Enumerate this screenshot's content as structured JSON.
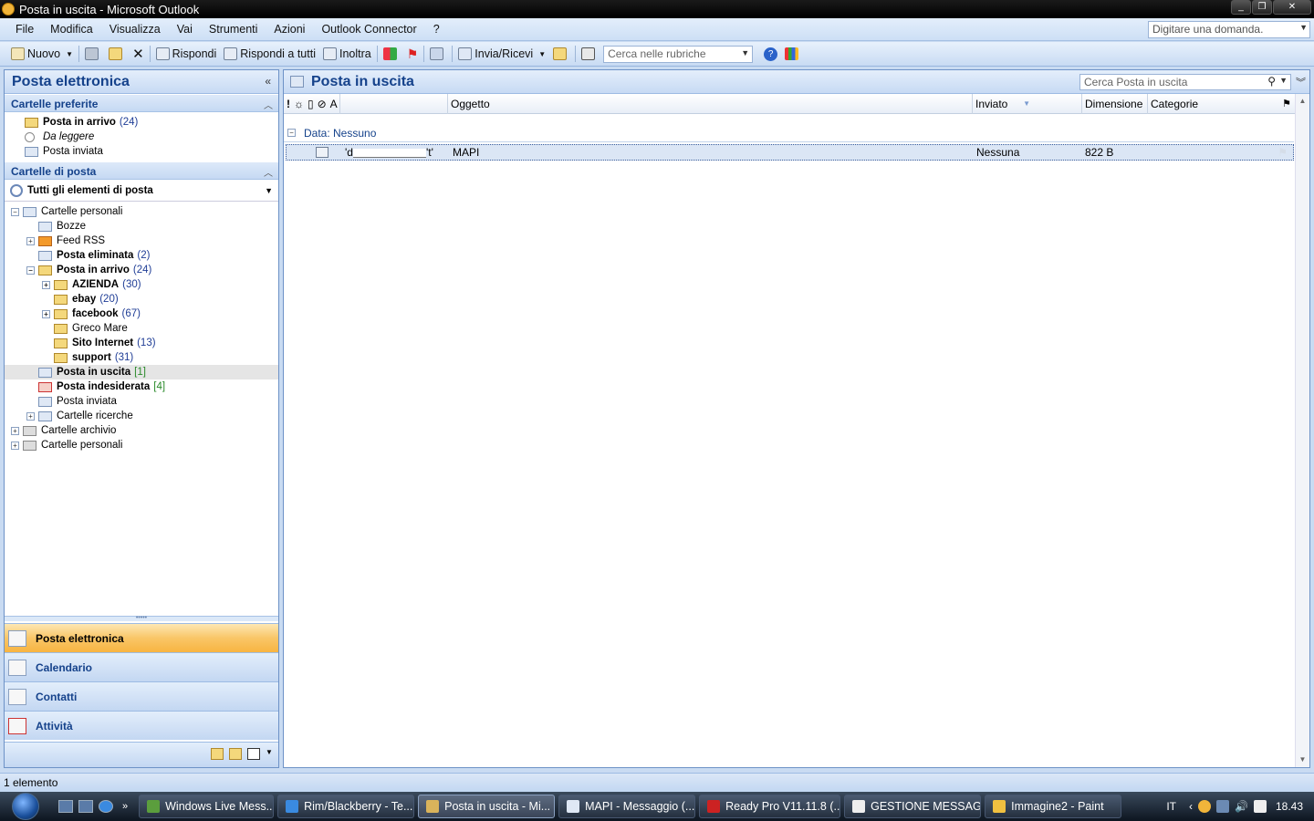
{
  "window": {
    "title": "Posta in uscita - Microsoft Outlook",
    "buttons": [
      "_",
      "❐",
      "✕"
    ]
  },
  "menu": {
    "items": [
      "File",
      "Modifica",
      "Visualizza",
      "Vai",
      "Strumenti",
      "Azioni",
      "Outlook Connector",
      "?"
    ],
    "ask_placeholder": "Digitare una domanda."
  },
  "toolbar": {
    "new": "Nuovo",
    "reply": "Rispondi",
    "reply_all": "Rispondi a tutti",
    "forward": "Inoltra",
    "send_receive": "Invia/Ricevi",
    "address_search_placeholder": "Cerca nelle rubriche"
  },
  "nav": {
    "title": "Posta elettronica",
    "favorites_title": "Cartelle preferite",
    "favorites": [
      {
        "label": "Posta in arrivo",
        "count": "(24)"
      },
      {
        "label": "Da leggere",
        "count": ""
      },
      {
        "label": "Posta inviata",
        "count": ""
      }
    ],
    "mail_folders_title": "Cartelle di posta",
    "all_items": "Tutti gli elementi di posta",
    "tree": [
      {
        "label": "Cartelle personali",
        "count": ""
      },
      {
        "label": "Bozze",
        "count": ""
      },
      {
        "label": "Feed RSS",
        "count": ""
      },
      {
        "label": "Posta eliminata",
        "count": "(2)"
      },
      {
        "label": "Posta in arrivo",
        "count": "(24)"
      },
      {
        "label": "AZIENDA",
        "count": "(30)"
      },
      {
        "label": "ebay",
        "count": "(20)"
      },
      {
        "label": "facebook",
        "count": "(67)"
      },
      {
        "label": "Greco Mare",
        "count": ""
      },
      {
        "label": "Sito Internet",
        "count": "(13)"
      },
      {
        "label": "support",
        "count": "(31)"
      },
      {
        "label": "Posta in uscita",
        "count": "[1]"
      },
      {
        "label": "Posta indesiderata",
        "count": "[4]"
      },
      {
        "label": "Posta inviata",
        "count": ""
      },
      {
        "label": "Cartelle ricerche",
        "count": ""
      },
      {
        "label": "Cartelle archivio",
        "count": ""
      },
      {
        "label": "Cartelle personali",
        "count": ""
      }
    ],
    "buttons": [
      "Posta elettronica",
      "Calendario",
      "Contatti",
      "Attività"
    ]
  },
  "main": {
    "title": "Posta in uscita",
    "search_placeholder": "Cerca Posta in uscita",
    "columns": [
      "A",
      "Oggetto",
      "Inviato",
      "Dimensione",
      "Categorie"
    ],
    "group_label": "Data: Nessuno",
    "messages": [
      {
        "to_prefix": "'d",
        "to_suffix": "'t'",
        "subject": "MAPI",
        "sent": "Nessuna",
        "size": "822 B"
      }
    ]
  },
  "status": {
    "text": "1 elemento"
  },
  "taskbar": {
    "tasks": [
      "Windows Live Mess...",
      "Rim/Blackberry - Te...",
      "Posta in uscita - Mi...",
      "MAPI - Messaggio (...",
      "Ready Pro V11.11.8 (...",
      "GESTIONE MESSAG...",
      "Immagine2 - Paint"
    ],
    "language": "IT",
    "clock": "18.43",
    "ql_more": "»"
  }
}
